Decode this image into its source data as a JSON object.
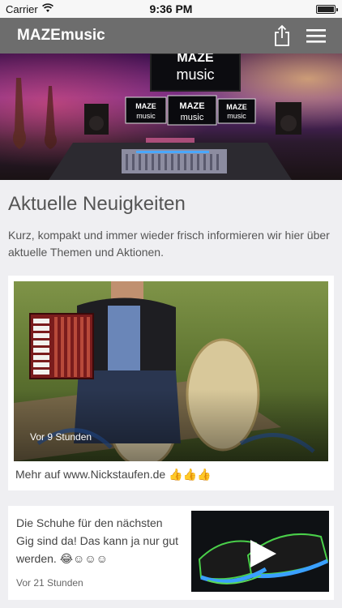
{
  "status_bar": {
    "carrier": "Carrier",
    "time": "9:36 PM"
  },
  "nav": {
    "title": "MAZEmusic",
    "share_icon": "share-icon",
    "menu_icon": "hamburger-menu-icon"
  },
  "hero": {
    "logo_line1": "MAZE",
    "logo_line2": "music"
  },
  "news": {
    "heading": "Aktuelle Neuigkeiten",
    "intro": "Kurz, kompakt und immer wieder frisch informieren wir hier über aktuelle Themen und Aktionen."
  },
  "posts": [
    {
      "timestamp": "Vor 9 Stunden",
      "caption": "Mehr auf www.Nickstaufen.de 👍👍👍"
    },
    {
      "text": "Die Schuhe für den nächsten Gig sind da! Das kann ja nur gut werden. 😂☺☺☺",
      "timestamp": "Vor 21 Stunden",
      "play_icon": "play-icon"
    }
  ],
  "colors": {
    "navbar": "#6d6d6d",
    "background": "#efeff2",
    "card": "#ffffff"
  }
}
